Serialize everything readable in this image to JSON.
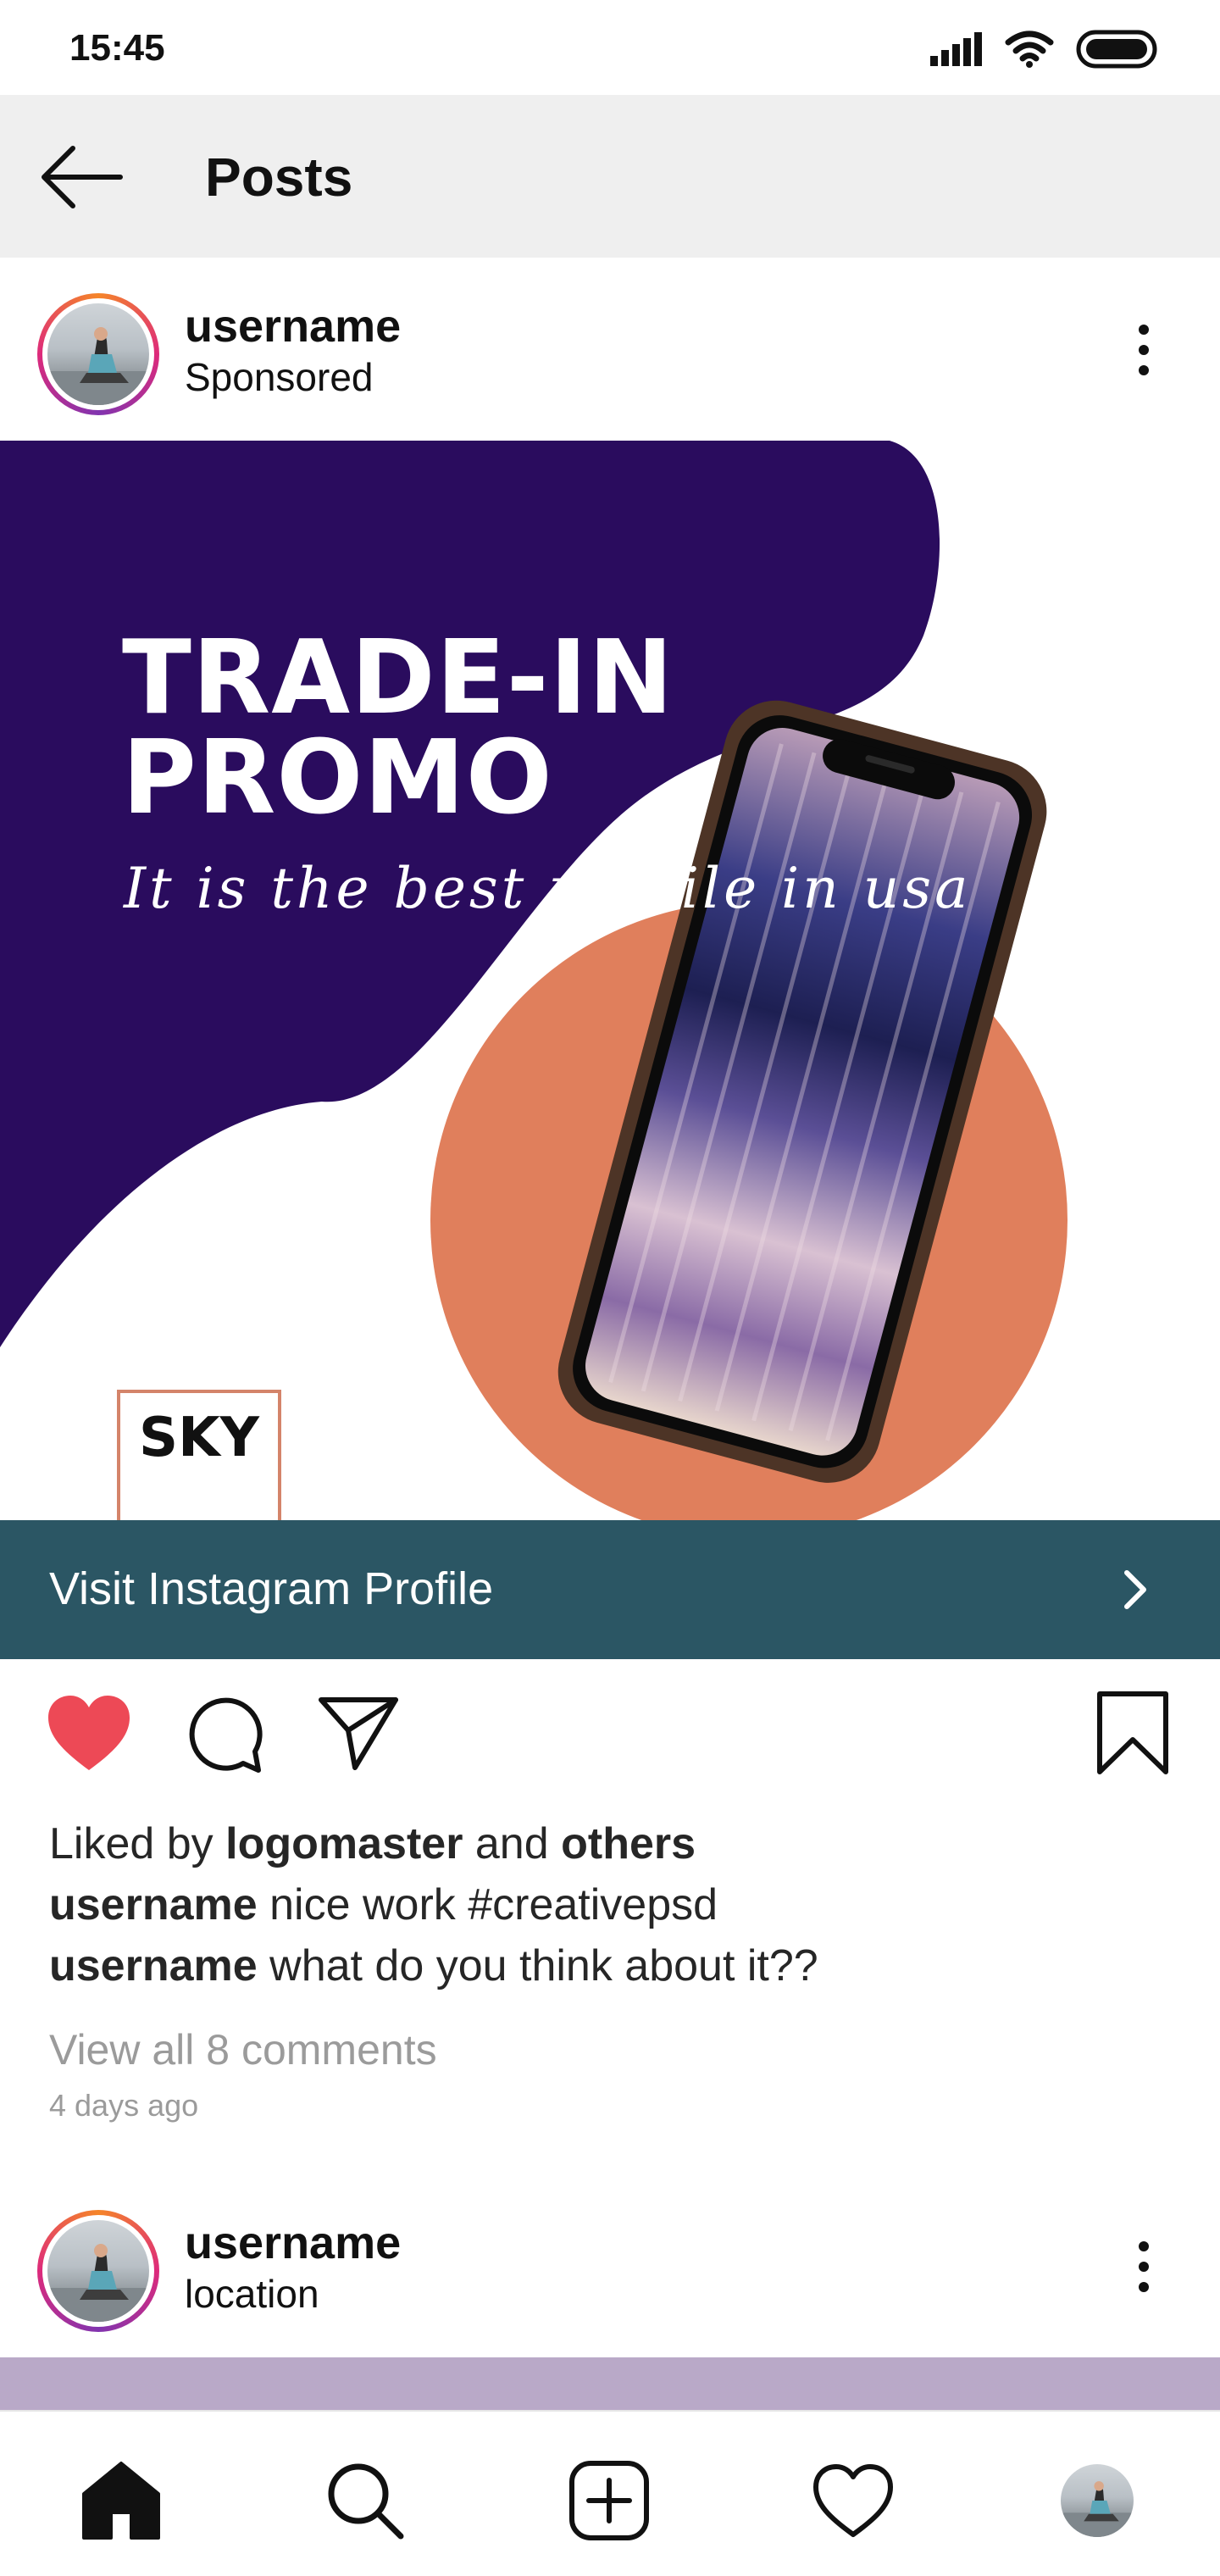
{
  "status_bar": {
    "time": "15:45",
    "icons": [
      "signal-icon",
      "wifi-icon",
      "battery-icon"
    ]
  },
  "top_bar": {
    "back_icon": "arrow-left-icon",
    "title": "Posts"
  },
  "posts": [
    {
      "username": "username",
      "subline": "Sponsored",
      "image": {
        "headline_line1": "TRADE-IN",
        "headline_line2": "PROMO",
        "tagline": "It is the best mobile in usa",
        "brand": "SKY",
        "colors": {
          "navy": "#2a0c5e",
          "coral": "#e07f5c",
          "brand_border": "#d4846a"
        }
      },
      "cta": {
        "label": "Visit Instagram Profile",
        "background": "#2b5664"
      },
      "liked": true,
      "likes": {
        "prefix": "Liked by",
        "user": "logomaster",
        "joiner": "and",
        "others": "others"
      },
      "captions": [
        {
          "user": "username",
          "text": "nice work #creativepsd"
        },
        {
          "user": "username",
          "text": "what do you think about it??"
        }
      ],
      "view_comments": "View all 8 comments",
      "time_ago": "4 days ago"
    },
    {
      "username": "username",
      "subline": "location"
    }
  ],
  "bottom_nav": {
    "items": [
      "home-icon",
      "search-icon",
      "add-post-icon",
      "activity-heart-icon",
      "profile-avatar"
    ]
  },
  "colors": {
    "like_red": "#ed4956",
    "top_bar_bg": "#efefef",
    "muted_text": "#9b9b9b"
  }
}
